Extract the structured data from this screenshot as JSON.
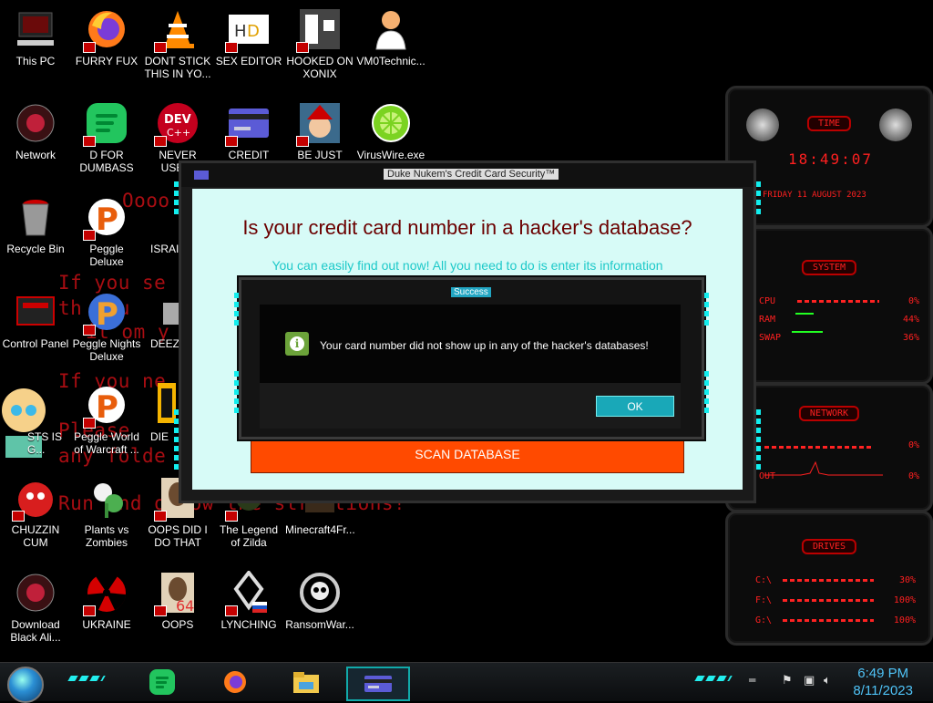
{
  "desktop_icons": [
    {
      "label": "This PC"
    },
    {
      "label": "FURRY FUX"
    },
    {
      "label": "DONT STICK THIS IN YO..."
    },
    {
      "label": "SEX EDITOR"
    },
    {
      "label": "HOOKED ON XONIX"
    },
    {
      "label": "VM0Technic..."
    },
    {
      "label": "Network"
    },
    {
      "label": "D FOR DUMBASS"
    },
    {
      "label": "NEVER USED!"
    },
    {
      "label": "CREDIT CARD"
    },
    {
      "label": "BE JUST LIKE"
    },
    {
      "label": "VirusWire.exe"
    },
    {
      "label": "Recycle Bin"
    },
    {
      "label": "Peggle Deluxe"
    },
    {
      "label": "ISRAI"
    },
    {
      "label": "Control Panel"
    },
    {
      "label": "Peggle Nights Deluxe"
    },
    {
      "label": "DEEZ"
    },
    {
      "label": "STS IS G..."
    },
    {
      "label": "Peggle World of Warcraft ..."
    },
    {
      "label": "DIE"
    },
    {
      "label": "CHUZZIN CUM"
    },
    {
      "label": "Plants vs Zombies"
    },
    {
      "label": "OOPS DID I DO THAT"
    },
    {
      "label": "The Legend of Zilda"
    },
    {
      "label": "Minecraft4Fr..."
    },
    {
      "label": "Download Black Ali..."
    },
    {
      "label": "UKRAINE"
    },
    {
      "label": "OOPS"
    },
    {
      "label": "LYNCHING"
    },
    {
      "label": "RansomWar..."
    }
  ],
  "background_text": {
    "l1": "Oooo",
    "l2": "If you se",
    "l3": "th  you",
    "l4": "it  om y",
    "l5": "If you ne",
    "l6": "Please",
    "l7": "any folde",
    "l8": "Run and  ollow the  structions!"
  },
  "widgets": {
    "time": {
      "title": "TIME",
      "clock": "18:49:07",
      "date": "FRIDAY 11 AUGUST 2023"
    },
    "system": {
      "title": "SYSTEM",
      "cpu_label": "CPU",
      "cpu_value": "0%",
      "ram_label": "RAM",
      "ram_value": "44%",
      "swap_label": "SWAP",
      "swap_value": "36%"
    },
    "network": {
      "title": "NETWORK",
      "in_value": "0%",
      "out_label": "OUT",
      "out_value": "0%"
    },
    "drives": {
      "title": "DRIVES",
      "c_label": "C:\\",
      "c_value": "30%",
      "f_label": "F:\\",
      "f_value": "100%",
      "g_label": "G:\\",
      "g_value": "100%"
    }
  },
  "main_window": {
    "title": "Duke Nukem's Credit Card Security™",
    "headline": "Is your credit card number in a hacker's database?",
    "subline": "You can easily find out now! All you need to do is enter its information",
    "scan_button": "SCAN DATABASE"
  },
  "dialog": {
    "title": "Success",
    "message": "Your card number did not show up in any of the hacker's databases!",
    "ok_label": "OK",
    "icon": "info-icon"
  },
  "taskbar": {
    "apps": [
      "spotify",
      "firefox",
      "file-explorer",
      "credit-card"
    ],
    "time": "6:49 PM",
    "date": "8/11/2023"
  },
  "colors": {
    "dialog_client_bg": "#d7fbf7",
    "headline": "#6b0000",
    "subline": "#1ec9c9",
    "scan_button": "#ff4a00",
    "ok_button": "#19a8b8",
    "widget_red": "#ff2020",
    "clock": "#4fc3f7"
  }
}
